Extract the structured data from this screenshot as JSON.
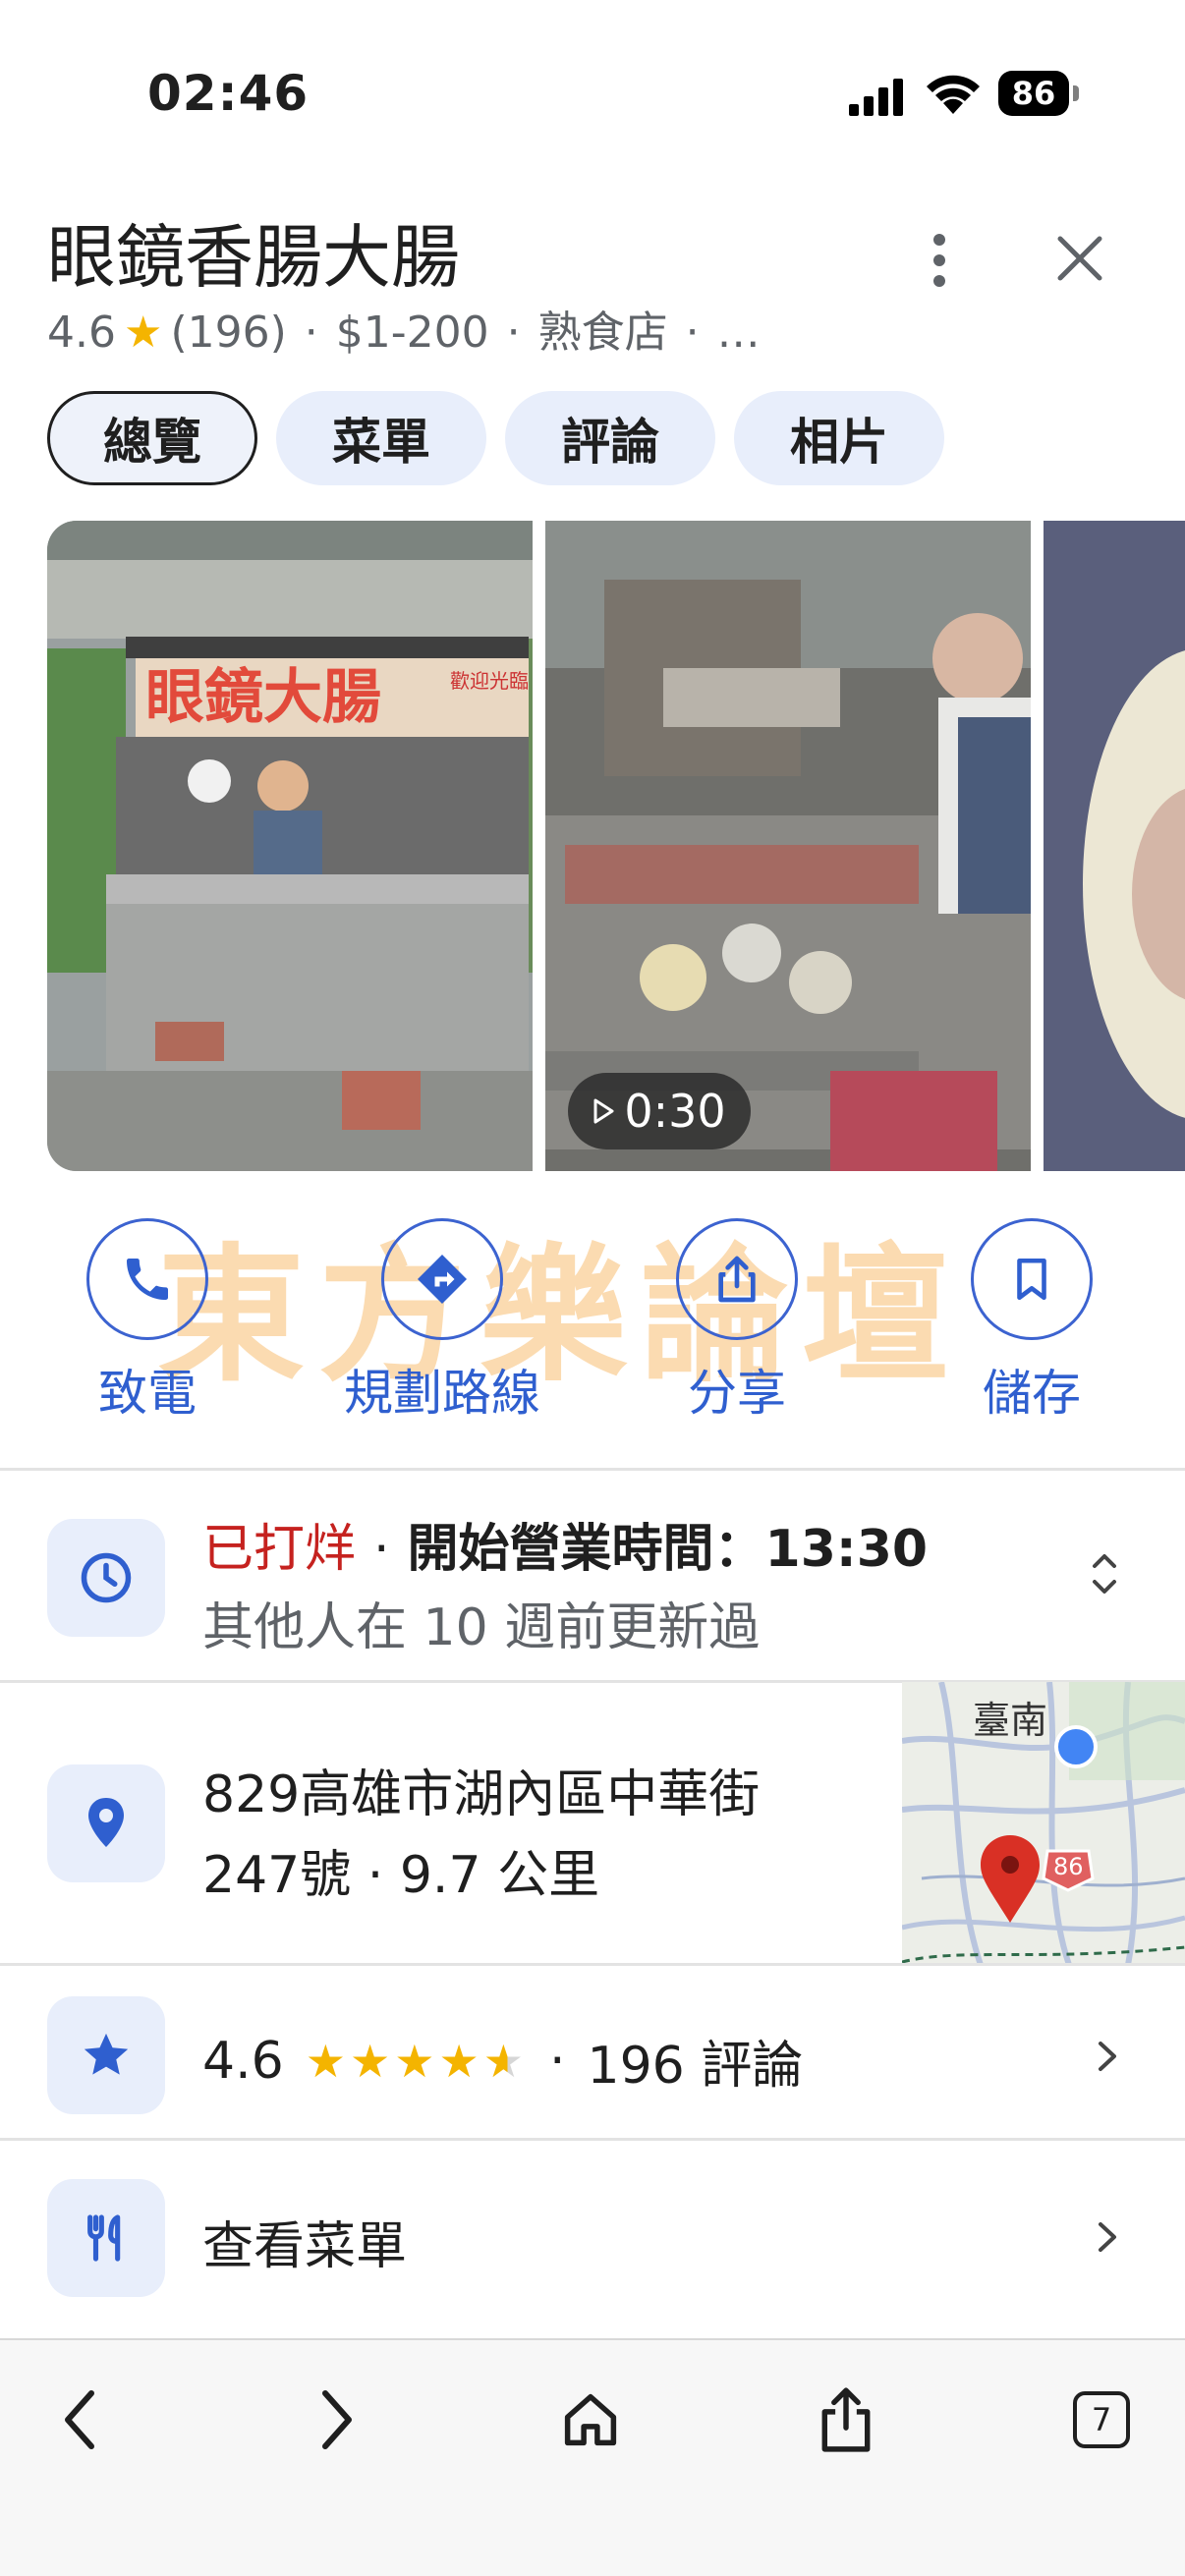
{
  "status_bar": {
    "time": "02:46",
    "battery": "86"
  },
  "place": {
    "title": "眼鏡香腸大腸",
    "rating": "4.6",
    "review_count": "(196)",
    "price": "$1-200",
    "category": "熟食店",
    "more": "…"
  },
  "tabs": [
    {
      "label": "總覽",
      "active": true
    },
    {
      "label": "菜單"
    },
    {
      "label": "評論"
    },
    {
      "label": "相片"
    }
  ],
  "photos": {
    "video_duration": "0:30",
    "sign_text": "眼鏡大腸",
    "sign_sub": "歡迎光臨"
  },
  "watermark": "東方樂論壇",
  "actions": [
    {
      "label": "致電",
      "icon": "phone-icon"
    },
    {
      "label": "規劃路線",
      "icon": "directions-icon"
    },
    {
      "label": "分享",
      "icon": "share-icon"
    },
    {
      "label": "儲存",
      "icon": "bookmark-icon"
    }
  ],
  "hours": {
    "status": "已打烊",
    "separator": "·",
    "open_time": "開始營業時間：13:30",
    "updated": "其他人在 10 週前更新過"
  },
  "address": {
    "line1": "829高雄市湖內區中華街",
    "line2": "247號 · 9.7 公里",
    "map_city": "臺南",
    "map_route": "86"
  },
  "rating_row": {
    "rating": "4.6",
    "separator": "·",
    "reviews": "196 評論",
    "stars": 4.6
  },
  "menu_row": {
    "label": "查看菜單"
  },
  "colors": {
    "accent": "#2f5fcf",
    "closed": "#c5221f",
    "star": "#f4b400"
  },
  "toolbar": {
    "tabs_count": "7"
  }
}
